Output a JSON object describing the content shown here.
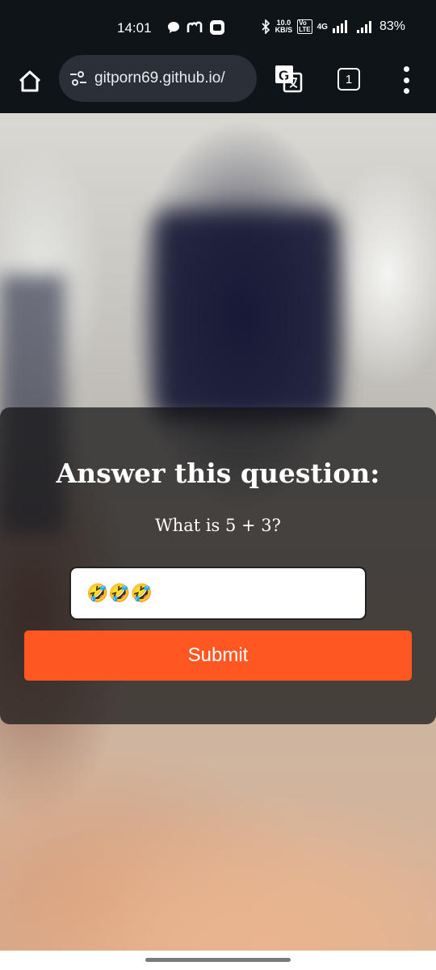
{
  "status_bar": {
    "time": "14:01",
    "speed_value": "10.0",
    "speed_unit": "KB/S",
    "volte_top": "Vo",
    "volte_bottom": "LTE",
    "network": "4G",
    "battery": "83%"
  },
  "browser": {
    "url": "gitporn69.github.io/",
    "tab_count": "1"
  },
  "modal": {
    "title": "Answer this question:",
    "question": "What is 5 + 3?",
    "input_value": "🤣🤣🤣",
    "submit_label": "Submit"
  },
  "colors": {
    "accent": "#ff5722",
    "toolbar": "#0f1419"
  }
}
